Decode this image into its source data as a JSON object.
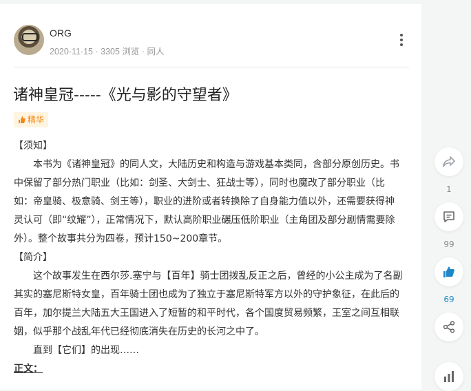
{
  "author": {
    "name": "ORG",
    "date": "2020-11-15",
    "views": "3305 浏览",
    "tag": "同人"
  },
  "article": {
    "title": "诸神皇冠-----《光与影的守望者》",
    "badge": "精华",
    "paragraphs": [
      "【须知】",
      "本书为《诸神皇冠》的同人文，大陆历史和构造与游戏基本类同，含部分原创历史。书中保留了部分热门职业（比如：剑圣、大剑士、狂战士等），同时也魔改了部分职业（比如：帝皇骑、极意骑、剑王等），职业的进阶或者转换除了自身能力值以外，还需要获得神灵认可（即“纹耀”），正常情况下，默认高阶职业碾压低阶职业（主角团及部分剧情需要除外）。整个故事共分为四卷，预计150~200章节。",
      "【简介】",
      "这个故事发生在西尔莎.塞宁与【百年】骑士团拨乱反正之后，曾经的小公主成为了名副其实的塞尼斯特女皇，百年骑士团也成为了独立于塞尼斯特军方以外的守护象征，在此后的百年，加尔提兰大陆五大王国进入了短暂的和平时代，各个国度贸易频繁，王室之间互相联姻，似乎那个战乱年代已经彻底消失在历史的长河之中了。",
      "直到【它们】的出现……",
      "正文："
    ]
  },
  "sidebar": {
    "share_count": "1",
    "comment_count": "99",
    "like_count": "69"
  },
  "colors": {
    "accent_blue": "#1e88c7",
    "badge_orange": "#ef8a1a"
  },
  "icons": [
    "more-icon",
    "forward-icon",
    "comment-icon",
    "thumbs-up-icon",
    "share-icon",
    "chart-icon",
    "fire-icon"
  ]
}
